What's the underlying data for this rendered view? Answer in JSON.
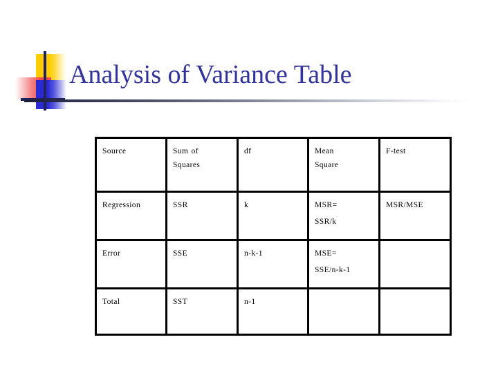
{
  "slide": {
    "title": "Analysis of Variance Table",
    "background_color": "#ffffff",
    "title_color": "#333399",
    "rule_color_start": "#1c1c3c",
    "rule_color_end": "#ffffff"
  },
  "logo": {
    "yellow_color": "#FFCC00",
    "red_color": "#F04A4A",
    "blue_color": "#2B2BD6",
    "cross_color": "#23235B"
  },
  "table": {
    "border_color": "#000000",
    "columns": [
      "Source",
      "Sum of\nSquares",
      "df",
      "Mean\nSquare",
      "F-test"
    ],
    "header": [
      {
        "lines": [
          "Source"
        ]
      },
      {
        "lines": [
          "Sum of",
          "Squares"
        ]
      },
      {
        "lines": [
          "df"
        ]
      },
      {
        "lines": [
          "Mean",
          "Square"
        ]
      },
      {
        "lines": [
          "F-test"
        ]
      }
    ],
    "rows": [
      {
        "name": "regression",
        "cells": [
          {
            "lines": [
              "Regression"
            ]
          },
          {
            "lines": [
              "SSR"
            ]
          },
          {
            "lines": [
              "k"
            ]
          },
          {
            "lines": [
              "MSR=",
              "SSR/k"
            ]
          },
          {
            "lines": [
              "MSR/MSE"
            ]
          }
        ]
      },
      {
        "name": "error",
        "cells": [
          {
            "lines": [
              "Error"
            ]
          },
          {
            "lines": [
              "SSE"
            ]
          },
          {
            "lines": [
              "n-k-1"
            ]
          },
          {
            "lines": [
              "MSE=",
              "SSE/n-k-1"
            ]
          },
          {
            "lines": [
              ""
            ]
          }
        ]
      },
      {
        "name": "total",
        "cells": [
          {
            "lines": [
              "Total"
            ]
          },
          {
            "lines": [
              "SST"
            ]
          },
          {
            "lines": [
              "n-1"
            ]
          },
          {
            "lines": [
              ""
            ]
          },
          {
            "lines": [
              ""
            ]
          }
        ]
      }
    ]
  }
}
